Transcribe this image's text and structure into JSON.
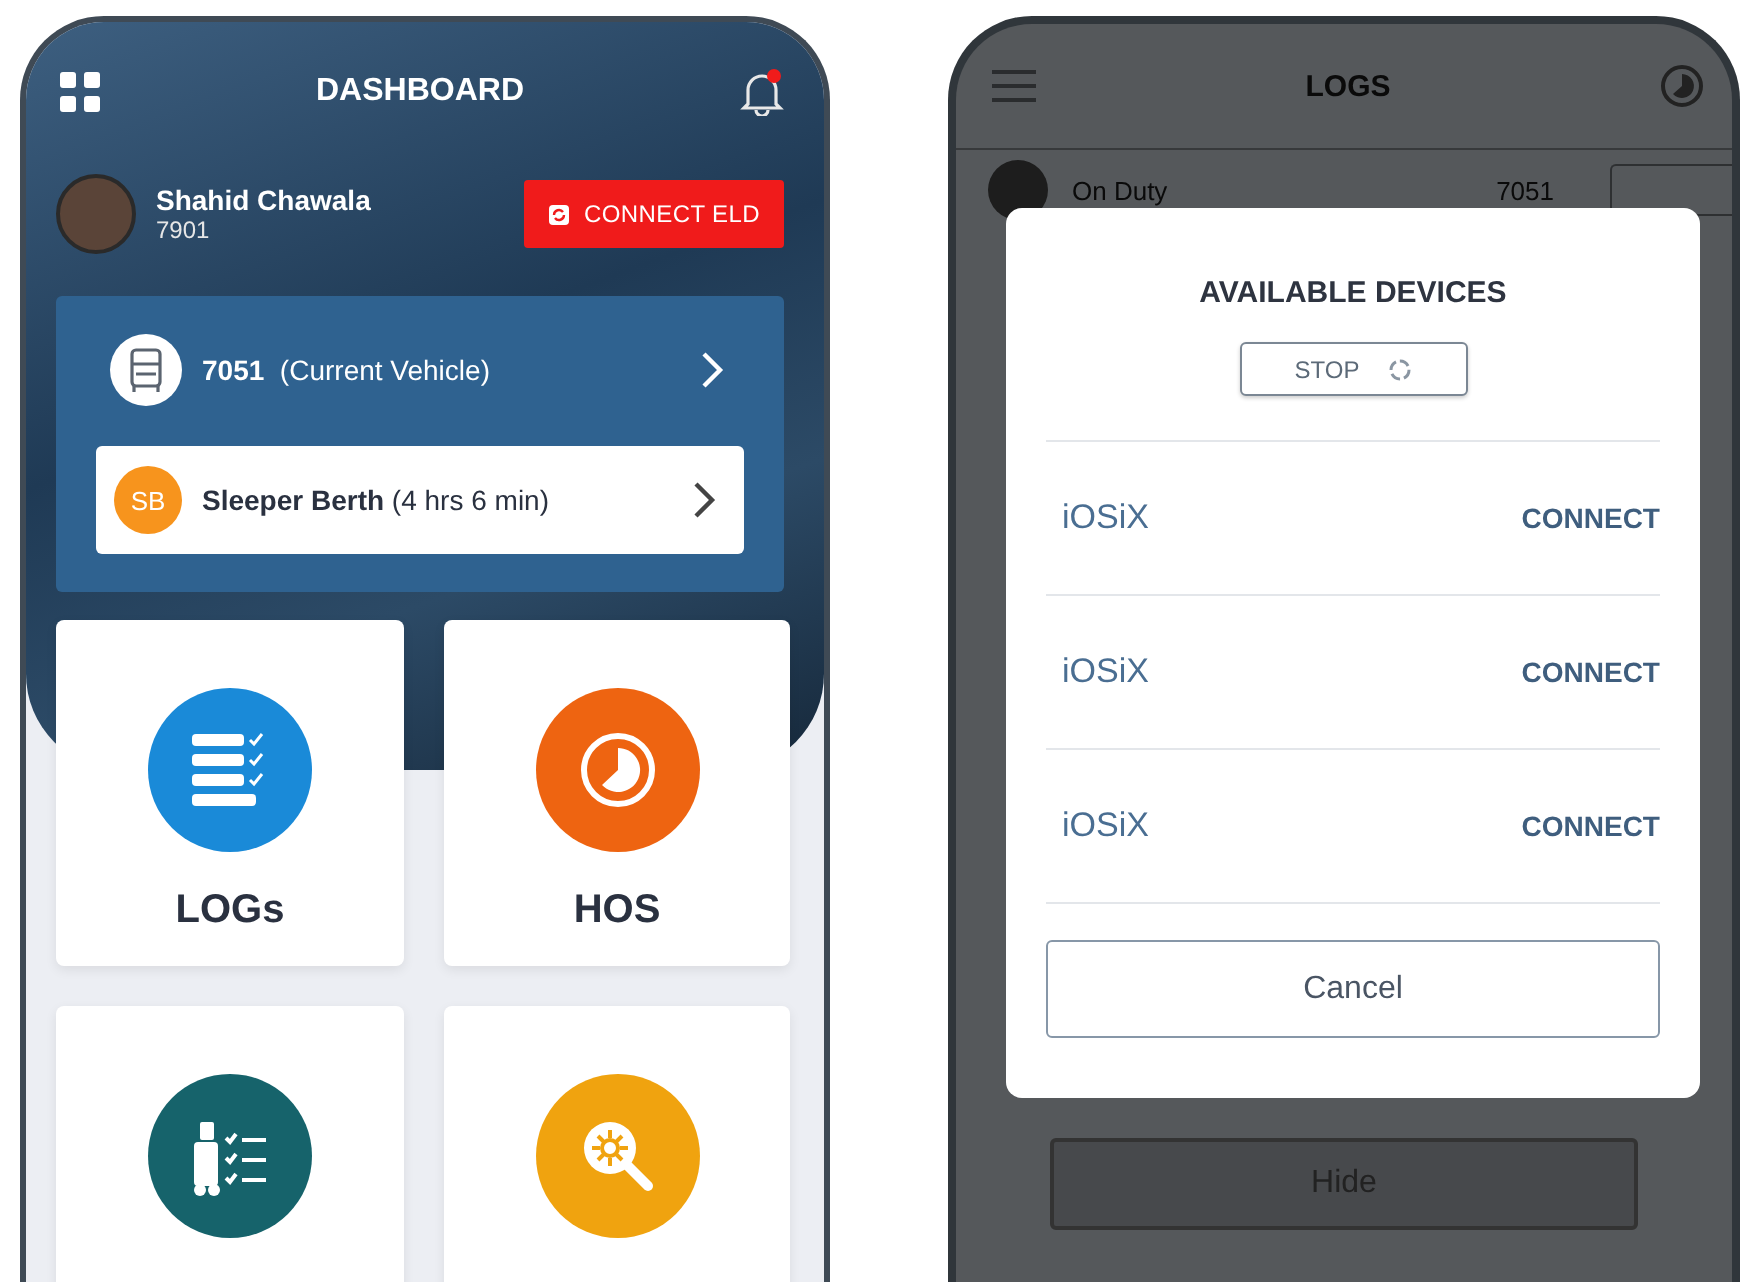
{
  "dashboard": {
    "title": "DASHBOARD",
    "driver": {
      "name": "Shahid Chawala",
      "id": "7901"
    },
    "connect_button": "CONNECT ELD",
    "vehicle": {
      "number": "7051",
      "label": "(Current Vehicle)"
    },
    "status": {
      "badge": "SB",
      "name": "Sleeper Berth",
      "duration": "(4 hrs 6 min)"
    },
    "tiles": [
      {
        "kind": "logs",
        "label": "LOGs",
        "color": "#1a8ad8"
      },
      {
        "kind": "hos",
        "label": "HOS",
        "color": "#ee6411"
      },
      {
        "kind": "inspection",
        "color": "#16636b"
      },
      {
        "kind": "search",
        "color": "#f0a30f"
      }
    ]
  },
  "logs_screen": {
    "title": "LOGS",
    "status": "On Duty",
    "vehicle": "7051",
    "hide_button": "Hide"
  },
  "devices_dialog": {
    "title": "AVAILABLE DEVICES",
    "stop_button": "STOP",
    "devices": [
      {
        "name": "iOSiX",
        "action": "CONNECT"
      },
      {
        "name": "iOSiX",
        "action": "CONNECT"
      },
      {
        "name": "iOSiX",
        "action": "CONNECT"
      }
    ],
    "cancel_button": "Cancel"
  }
}
